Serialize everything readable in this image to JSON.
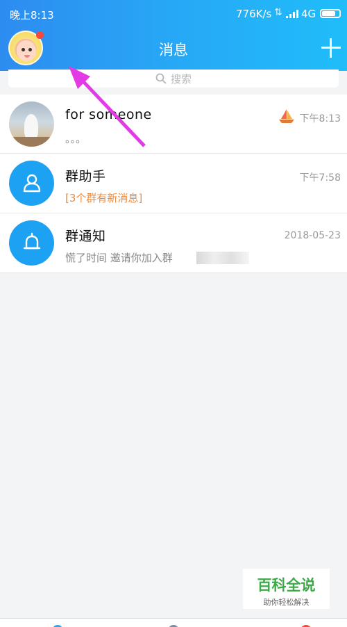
{
  "status_bar": {
    "time": "晚上8:13",
    "speed": "776K/s",
    "network": "4G",
    "battery_level": 0.8
  },
  "header": {
    "title": "消息"
  },
  "search": {
    "placeholder": "搜索"
  },
  "conversations": [
    {
      "name": "for  someone",
      "preview": "。。。",
      "time": "下午8:13",
      "icon": "photo-avatar",
      "badge_icon": "sailboat-icon"
    },
    {
      "name": "群助手",
      "preview": "[3个群有新消息]",
      "time": "下午7:58",
      "icon": "group-helper-icon"
    },
    {
      "name": "群通知",
      "preview": "慌了时间 邀请你加入群",
      "time": "2018-05-23",
      "icon": "bell-icon"
    }
  ],
  "watermark": {
    "title": "百科全说",
    "subtitle": "助你轻松解决"
  },
  "colors": {
    "header_start": "#2d8cf0",
    "header_end": "#20bdf9",
    "icon_blue": "#1da1f2",
    "highlight_orange": "#f08a3a",
    "annotation_arrow": "#e23be6",
    "notification_dot": "#f04a3f"
  }
}
